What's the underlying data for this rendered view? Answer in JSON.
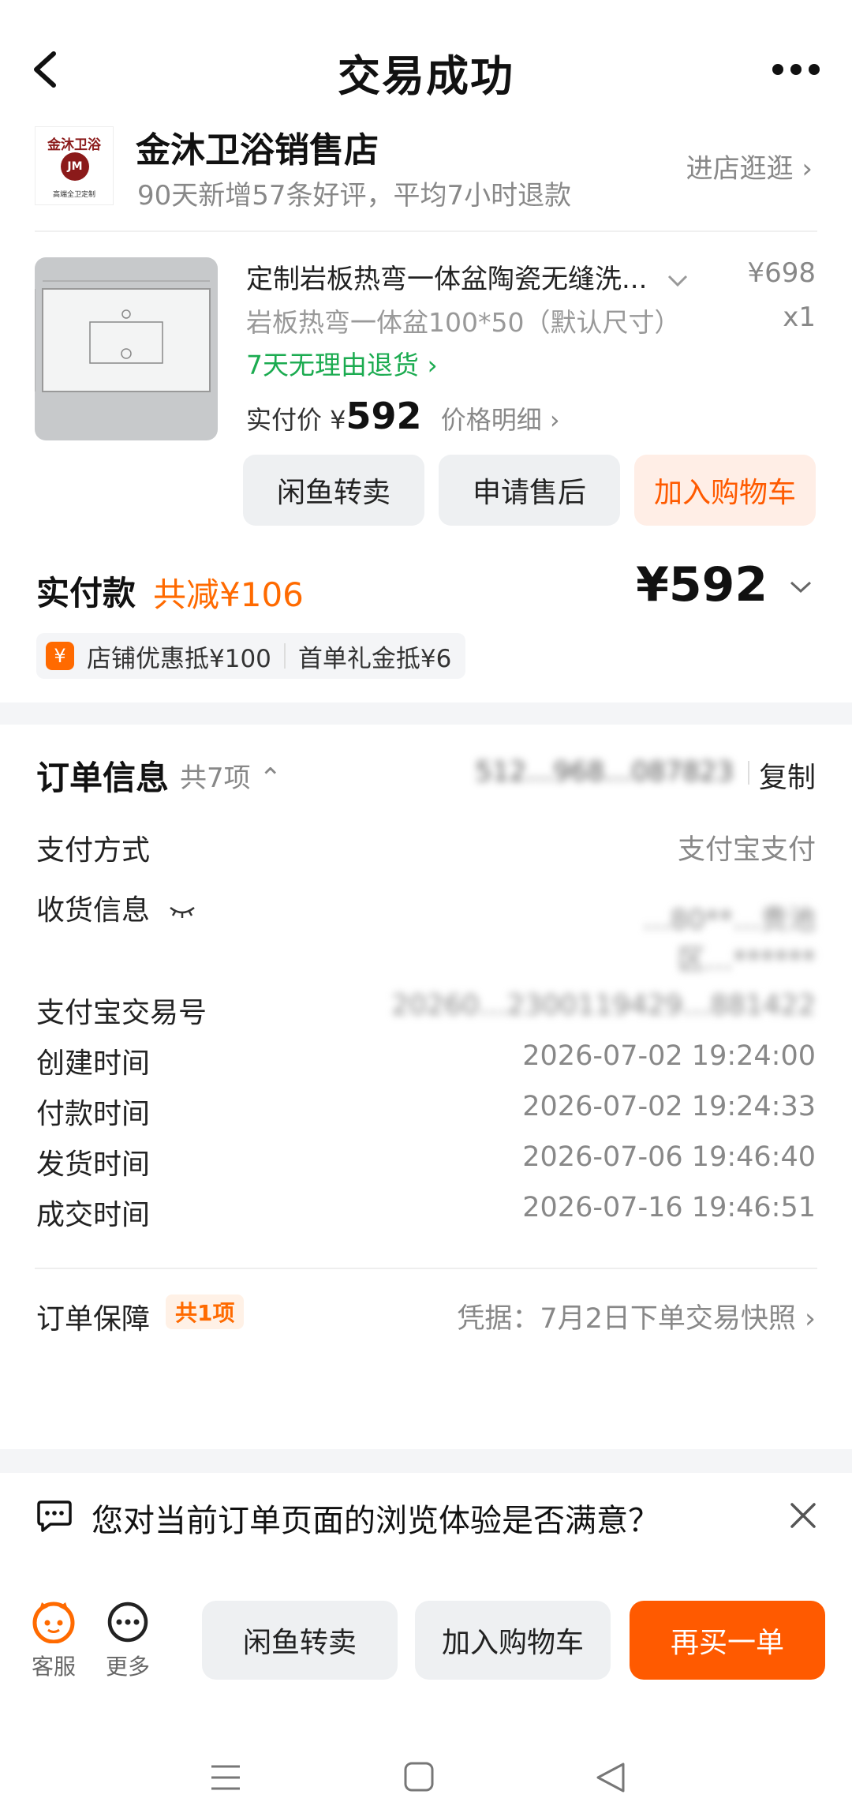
{
  "header": {
    "title": "交易成功"
  },
  "shop": {
    "logo_text": "金沐卫浴",
    "logo_initials": "JM",
    "logo_sub": "高端全卫定制",
    "name": "金沐卫浴销售店",
    "subtitle": "90天新增57条好评，平均7小时退款",
    "enter_label": "进店逛逛 ›"
  },
  "product": {
    "title": "定制岩板热弯一体盆陶瓷无缝洗...",
    "price": "¥698",
    "sku": "岩板热弯一体盆100*50（默认尺寸）",
    "qty": "x1",
    "return_policy": "7天无理由退货 ›",
    "pay_label": "实付价 ¥",
    "pay_amount": "592",
    "price_detail": "价格明细 ›",
    "buttons": [
      "闲鱼转卖",
      "申请售后",
      "加入购物车"
    ]
  },
  "payment": {
    "label": "实付款",
    "reduction": "共减¥106",
    "total": "¥592",
    "coupon_icon": "¥",
    "coupon1": "店铺优惠抵¥100",
    "coupon2": "首单礼金抵¥6"
  },
  "order_info": {
    "title": "订单信息",
    "count": "共7项 ⌃",
    "order_no": "512…968…087823",
    "copy_label": "复制",
    "rows": [
      {
        "label": "支付方式",
        "value": "支付宝支付"
      },
      {
        "label": "收货信息",
        "value_line1": "…80**…贵池",
        "value_line2": "区…******"
      },
      {
        "label": "支付宝交易号",
        "value": "20260…2300119429…881422"
      },
      {
        "label": "创建时间",
        "value": "2026-07-02 19:24:00"
      },
      {
        "label": "付款时间",
        "value": "2026-07-02 19:24:33"
      },
      {
        "label": "发货时间",
        "value": "2026-07-06 19:46:40"
      },
      {
        "label": "成交时间",
        "value": "2026-07-16 19:46:51"
      }
    ],
    "guarantee_label": "订单保障",
    "guarantee_badge": "共1项",
    "guarantee_value": "凭据：7月2日下单交易快照 ›"
  },
  "feedback": {
    "question": "您对当前订单页面的浏览体验是否满意？"
  },
  "bottom_bar": {
    "service_label": "客服",
    "more_label": "更多",
    "btn_resell": "闲鱼转卖",
    "btn_cart": "加入购物车",
    "btn_rebuy": "再买一单"
  }
}
